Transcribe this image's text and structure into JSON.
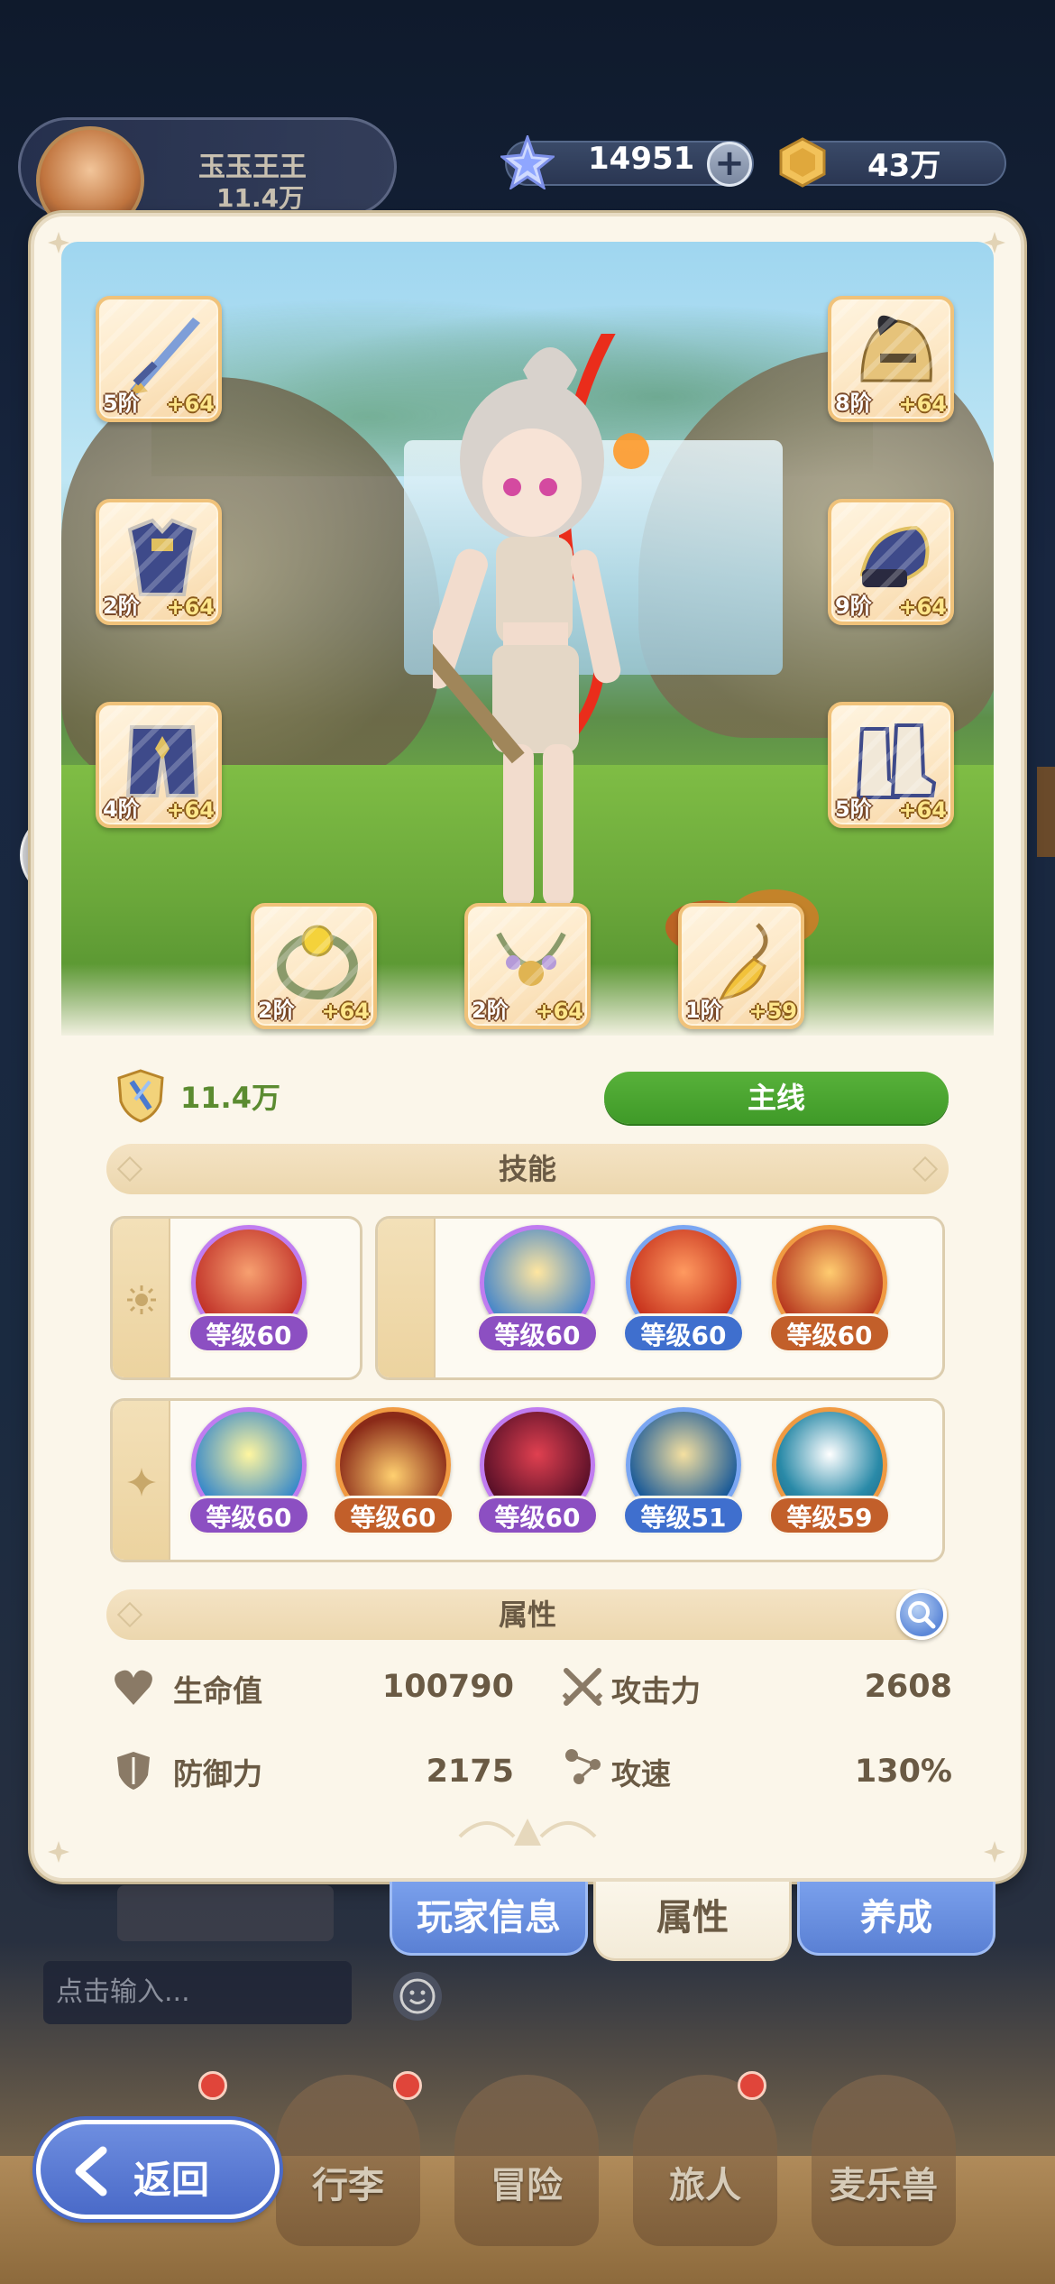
{
  "background": {
    "player_name": "玉玉王王",
    "player_power": "11.4万"
  },
  "currency": {
    "gems": "14951",
    "coins": "43万"
  },
  "equipment": [
    {
      "slot": "weapon",
      "tier": "5阶",
      "plus": "+64"
    },
    {
      "slot": "helmet",
      "tier": "8阶",
      "plus": "+64"
    },
    {
      "slot": "armor",
      "tier": "2阶",
      "plus": "+64"
    },
    {
      "slot": "gloves",
      "tier": "9阶",
      "plus": "+64"
    },
    {
      "slot": "pants",
      "tier": "4阶",
      "plus": "+64"
    },
    {
      "slot": "boots",
      "tier": "5阶",
      "plus": "+64"
    },
    {
      "slot": "ring",
      "tier": "2阶",
      "plus": "+64"
    },
    {
      "slot": "necklace",
      "tier": "2阶",
      "plus": "+64"
    },
    {
      "slot": "charm",
      "tier": "1阶",
      "plus": "+59"
    }
  ],
  "power": "11.4万",
  "main_quest_button": "主线",
  "sections": {
    "skills": "技能",
    "attributes": "属性"
  },
  "skills": {
    "sun": [
      {
        "level": "等级60",
        "rarity": "purple"
      }
    ],
    "moon": [
      {
        "level": "等级60",
        "rarity": "purple"
      },
      {
        "level": "等级60",
        "rarity": "blue"
      },
      {
        "level": "等级60",
        "rarity": "orange"
      }
    ],
    "star": [
      {
        "level": "等级60",
        "rarity": "purple"
      },
      {
        "level": "等级60",
        "rarity": "orange"
      },
      {
        "level": "等级60",
        "rarity": "purple"
      },
      {
        "level": "等级51",
        "rarity": "blue"
      },
      {
        "level": "等级59",
        "rarity": "orange"
      }
    ]
  },
  "attributes": [
    {
      "label": "生命值",
      "value": "100790",
      "icon": "heart-icon"
    },
    {
      "label": "攻击力",
      "value": "2608",
      "icon": "crossed-swords-icon"
    },
    {
      "label": "防御力",
      "value": "2175",
      "icon": "shield-icon"
    },
    {
      "label": "攻速",
      "value": "130%",
      "icon": "speed-icon"
    }
  ],
  "tabs": {
    "player_info": "玩家信息",
    "attributes": "属性",
    "develop": "养成"
  },
  "chat": {
    "placeholder": "点击输入..."
  },
  "nav": {
    "back": "返回",
    "bag": "行李",
    "adventure": "冒险",
    "traveler": "旅人",
    "pet": "麦乐兽"
  },
  "colors": {
    "panel_bg": "#fbf6ea",
    "main_button": "#4aa52f",
    "purple_rarity": "#8c4fc2",
    "blue_rarity": "#3f6fce",
    "orange_rarity": "#c25f2a",
    "tab_blue": "#6a90e0"
  }
}
